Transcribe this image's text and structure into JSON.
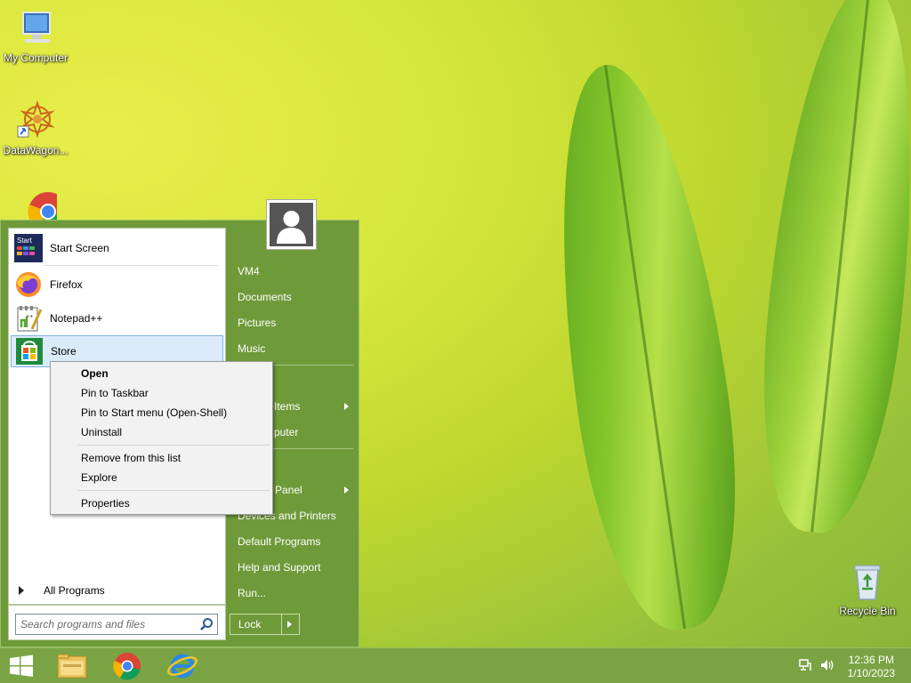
{
  "desktop": {
    "icons": [
      {
        "label": "My Computer"
      },
      {
        "label": "DataWagon..."
      },
      {
        "label": "Recycle Bin"
      }
    ]
  },
  "start_menu": {
    "programs": [
      {
        "label": "Start Screen",
        "icon": "start-screen-icon"
      },
      {
        "label": "Firefox",
        "icon": "firefox-icon"
      },
      {
        "label": "Notepad++",
        "icon": "notepad-plus-plus-icon"
      },
      {
        "label": "Store",
        "icon": "store-icon"
      }
    ],
    "all_programs": "All Programs",
    "search_placeholder": "Search programs and files",
    "right_items": [
      {
        "label": "VM4"
      },
      {
        "label": "Documents"
      },
      {
        "label": "Pictures"
      },
      {
        "label": "Music"
      },
      {
        "label": "Items"
      },
      {
        "label": "puter"
      },
      {
        "label": "Panel"
      },
      {
        "label": "Devices and Printers"
      },
      {
        "label": "Default Programs"
      },
      {
        "label": "Help and Support"
      },
      {
        "label": "Run..."
      }
    ],
    "lock_label": "Lock"
  },
  "context_menu": {
    "items": [
      {
        "label": "Open",
        "bold": true
      },
      {
        "label": "Pin to Taskbar"
      },
      {
        "label": "Pin to Start menu (Open-Shell)"
      },
      {
        "label": "Uninstall"
      },
      {
        "label": "Remove from this list"
      },
      {
        "label": "Explore"
      },
      {
        "label": "Properties"
      }
    ]
  },
  "taskbar": {
    "time": "12:36 PM",
    "date": "1/10/2023"
  },
  "colors": {
    "start_menu_bg": "#6f9a3a",
    "taskbar_bg": "#7aa444",
    "selection": "#dcebfb"
  }
}
